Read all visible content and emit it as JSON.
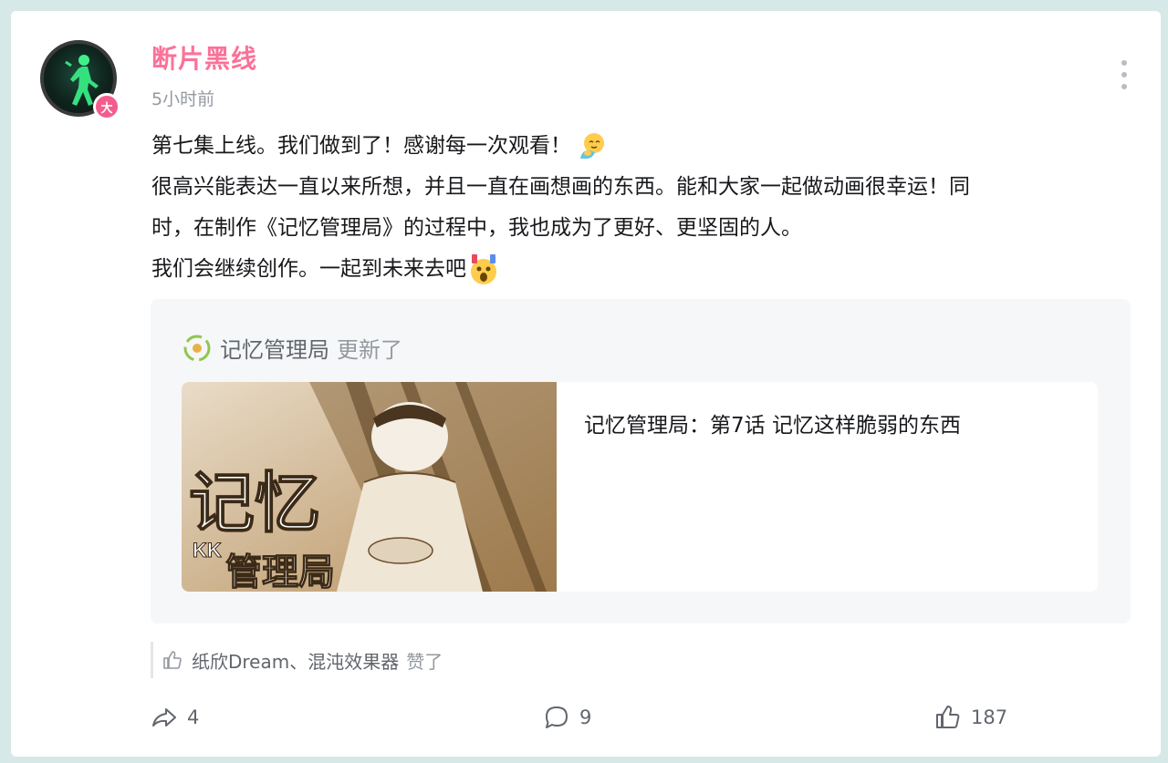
{
  "post": {
    "author": "断片黑线",
    "badge": "大",
    "time": "5小时前",
    "lines": [
      "第七集上线。我们做到了！感谢每一次观看！",
      "很高兴能表达一直以来所想，并且一直在画想画的东西。能和大家一起做动画很幸运！同",
      "时，在制作《记忆管理局》的过程中，我也成为了更好、更坚固的人。",
      "我们会继续创作。一起到未来去吧"
    ]
  },
  "repost": {
    "name": "记忆管理局",
    "action": "更新了",
    "video": {
      "title": "记忆管理局：第7话 记忆这样脆弱的东西",
      "thumb_text_top": "记忆",
      "thumb_text_bottom": "管理局",
      "thumb_tag": "KK"
    }
  },
  "likes": {
    "names": "纸欣Dream、混沌效果器",
    "suffix": "赞了"
  },
  "actions": {
    "share_count": "4",
    "comment_count": "9",
    "like_count": "187"
  },
  "colors": {
    "author": "#fb7299",
    "badge": "#f25d8e",
    "background": "#d6e8e7",
    "repost_bg": "#f6f7f8"
  },
  "icons": [
    "more-icon",
    "hug-emoji-icon",
    "shocked-emoji-icon",
    "recycle-icon",
    "thumbs-up-icon",
    "share-icon",
    "comment-icon",
    "like-icon"
  ]
}
